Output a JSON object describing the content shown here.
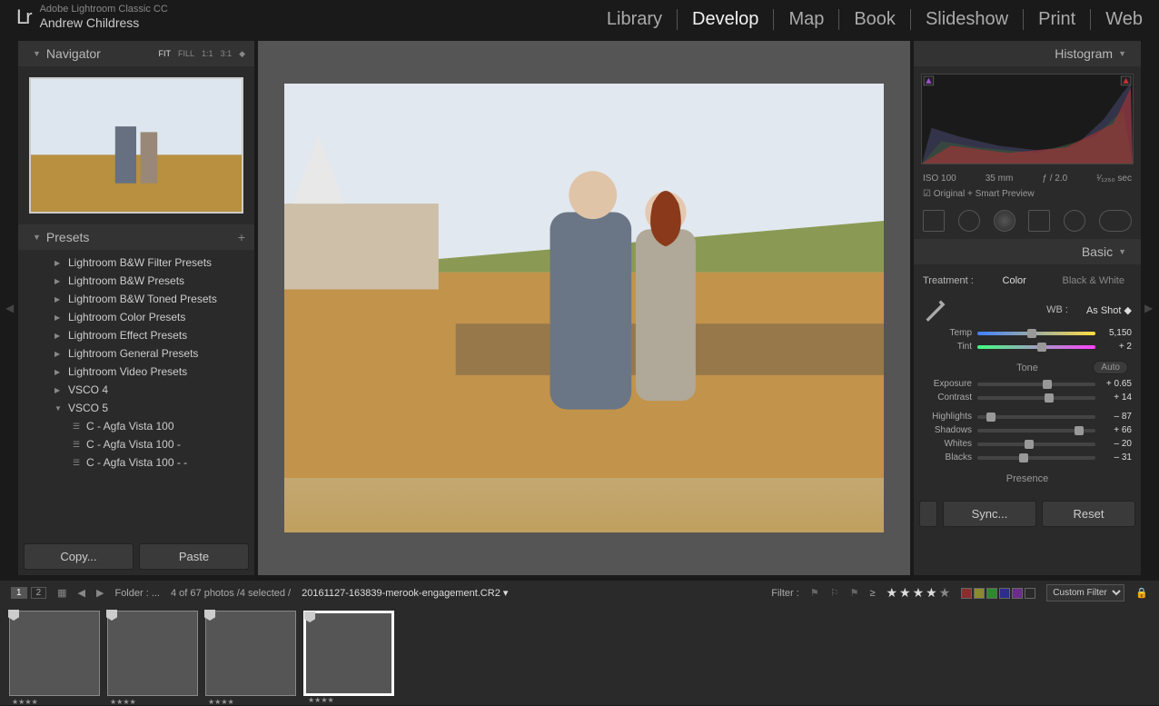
{
  "app": {
    "product": "Adobe Lightroom Classic CC",
    "user": "Andrew Childress",
    "logo": "Lr"
  },
  "modules": {
    "items": [
      "Library",
      "Develop",
      "Map",
      "Book",
      "Slideshow",
      "Print",
      "Web"
    ],
    "active": "Develop"
  },
  "navigator": {
    "title": "Navigator",
    "zooms": [
      "FIT",
      "FILL",
      "1:1",
      "3:1"
    ],
    "zoom_active": "FIT"
  },
  "presets": {
    "title": "Presets",
    "items": [
      "Lightroom B&W Filter Presets",
      "Lightroom B&W Presets",
      "Lightroom B&W Toned Presets",
      "Lightroom Color Presets",
      "Lightroom Effect Presets",
      "Lightroom General Presets",
      "Lightroom Video Presets",
      "VSCO 4",
      "VSCO 5"
    ],
    "open_index": 8,
    "sub": [
      "C - Agfa Vista 100",
      "C - Agfa Vista 100 -",
      "C - Agfa Vista 100 - -"
    ]
  },
  "leftbuttons": {
    "copy": "Copy...",
    "paste": "Paste"
  },
  "histogram": {
    "title": "Histogram",
    "iso": "ISO 100",
    "focal": "35 mm",
    "aperture": "ƒ / 2.0",
    "shutter": "¹⁄₁₂₅₀ sec",
    "preview": "Original + Smart Preview"
  },
  "basic": {
    "title": "Basic",
    "treatment_label": "Treatment :",
    "treatment": {
      "color": "Color",
      "bw": "Black & White"
    },
    "wb_label": "WB :",
    "wb_value": "As Shot",
    "temp": {
      "label": "Temp",
      "val": "5,150",
      "pos": 42
    },
    "tint": {
      "label": "Tint",
      "val": "+ 2",
      "pos": 51
    },
    "tone": {
      "title": "Tone",
      "auto": "Auto",
      "exposure": {
        "label": "Exposure",
        "val": "+ 0.65",
        "pos": 55
      },
      "contrast": {
        "label": "Contrast",
        "val": "+ 14",
        "pos": 57
      },
      "highlights": {
        "label": "Highlights",
        "val": "– 87",
        "pos": 8
      },
      "shadows": {
        "label": "Shadows",
        "val": "+ 66",
        "pos": 82
      },
      "whites": {
        "label": "Whites",
        "val": "– 20",
        "pos": 40
      },
      "blacks": {
        "label": "Blacks",
        "val": "– 31",
        "pos": 35
      }
    },
    "presence": {
      "title": "Presence"
    }
  },
  "rightbuttons": {
    "sync": "Sync...",
    "reset": "Reset"
  },
  "filmstrip": {
    "views": [
      "1",
      "2"
    ],
    "active": "1",
    "folder_label": "Folder : ...",
    "count": "4 of 67 photos /4 selected /",
    "filename": "20161127-163839-merook-engagement.CR2",
    "filter_label": "Filter :",
    "custom": "Custom Filter",
    "thumb_count": 4,
    "selected_index": 3
  }
}
